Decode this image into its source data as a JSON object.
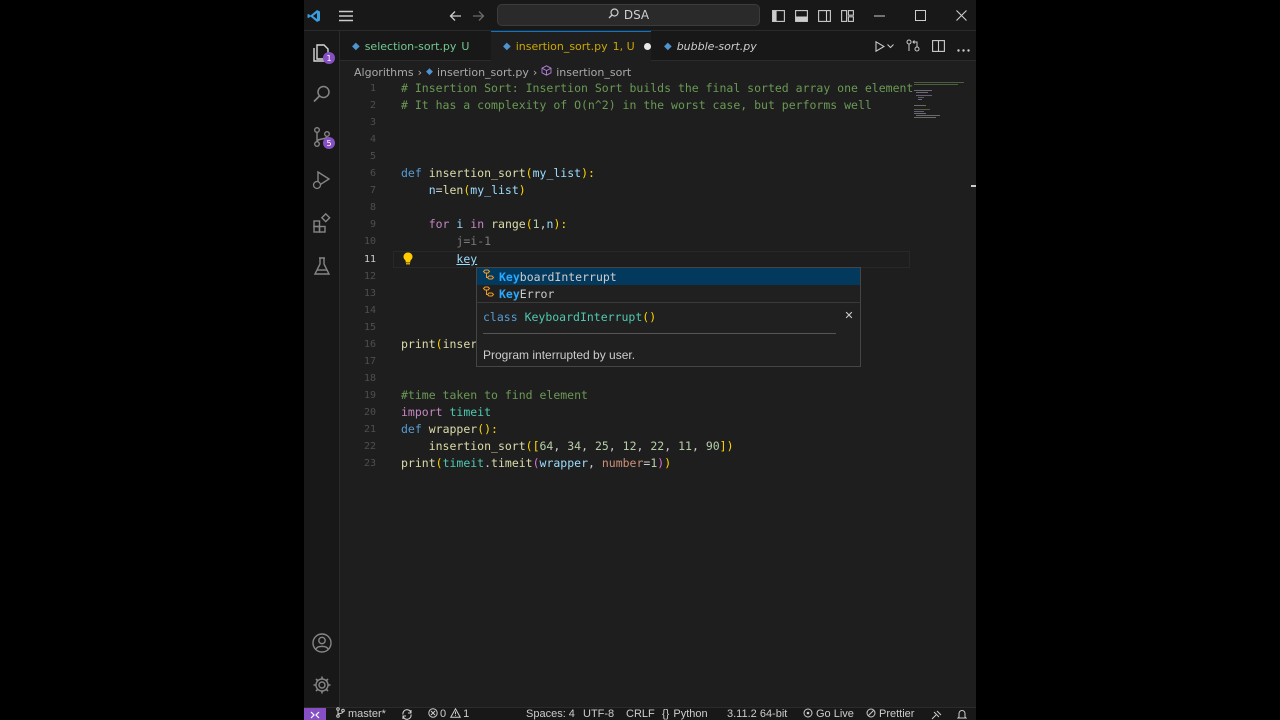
{
  "titlebar": {
    "search_text": "DSA"
  },
  "activity": {
    "explorer_badge": "1",
    "scm_badge": "5"
  },
  "tabs": [
    {
      "label": "selection-sort.py",
      "status": "U",
      "color": "#73c991"
    },
    {
      "label": "insertion_sort.py",
      "status": "1, U",
      "color": "#cca700"
    },
    {
      "label": "bubble-sort.py",
      "status": "",
      "color": "#cccccc"
    }
  ],
  "breadcrumb": {
    "folder": "Algorithms",
    "file": "insertion_sort.py",
    "symbol": "insertion_sort"
  },
  "editor": {
    "line_numbers": [
      "1",
      "2",
      "3",
      "4",
      "5",
      "6",
      "7",
      "8",
      "9",
      "10",
      "11",
      "12",
      "13",
      "14",
      "15",
      "16",
      "17",
      "18",
      "19",
      "20",
      "21",
      "22",
      "23"
    ],
    "current_line": "11",
    "comment1": "# Insertion Sort: Insertion Sort builds the final sorted array one element",
    "comment2": "# It has a complexity of O(n^2) in the worst case, but performs well",
    "line6": {
      "kw": "def",
      "fn": "insertion_sort",
      "open": "(",
      "param": "my_list",
      "close": "):"
    },
    "line7": {
      "var": "n",
      "eq": "=",
      "fn": "len",
      "open": "(",
      "arg": "my_list",
      "close": ")"
    },
    "line9": {
      "kw": "for",
      "var": "i",
      "in": "in",
      "fn": "range",
      "open": "(",
      "n1": "1",
      "comma": ",",
      "arg": "n",
      "close": "):"
    },
    "line10": {
      "var": "j",
      "eq": "=",
      "var2": "i",
      "minus": "-",
      "n1": "1"
    },
    "line11": {
      "typed": "key"
    },
    "line16": {
      "fn": "print",
      "open": "(",
      "rest": "inser"
    },
    "line19": {
      "comment": "#time taken to find element"
    },
    "line20": {
      "kw": "import",
      "mod": "timeit"
    },
    "line21": {
      "kw": "def",
      "fn": "wrapper",
      "paren": "():"
    },
    "line22": {
      "fn": "insertion_sort",
      "open": "([",
      "nums": [
        "64",
        "34",
        "25",
        "12",
        "22",
        "11",
        "90"
      ],
      "close": "])"
    },
    "line23": {
      "fn": "print",
      "open1": "(",
      "mod": "timeit",
      "dot": ".",
      "fn2": "timeit",
      "open2": "(",
      "arg": "wrapper",
      "comma": ", ",
      "kw": "number",
      "eq": "=",
      "n1": "1",
      "close2": ")",
      "close1": ")"
    }
  },
  "suggest": {
    "items": [
      {
        "match": "Key",
        "rest": "boardInterrupt"
      },
      {
        "match": "Key",
        "rest": "Error"
      }
    ],
    "details": {
      "kw": "class",
      "name": "KeyboardInterrupt",
      "paren": "()",
      "doc": "Program interrupted by user."
    }
  },
  "statusbar": {
    "branch": "master*",
    "errors": "0",
    "warnings": "1",
    "spaces": "Spaces: 4",
    "encoding": "UTF-8",
    "eol": "CRLF",
    "language": "Python",
    "interpreter": "3.11.2 64-bit",
    "golive": "Go Live",
    "prettier": "Prettier"
  }
}
